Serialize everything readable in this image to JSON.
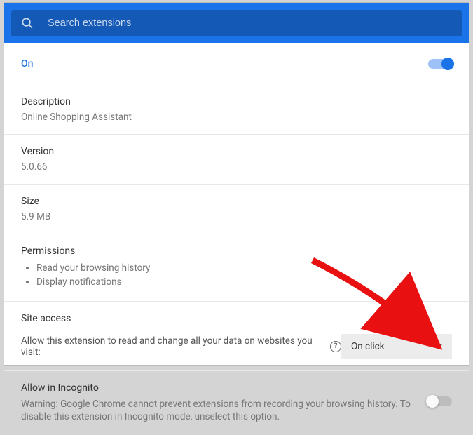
{
  "header": {
    "search_placeholder": "Search extensions"
  },
  "status": {
    "on_label": "On",
    "enabled": true
  },
  "description": {
    "title": "Description",
    "value": "Online Shopping Assistant"
  },
  "version": {
    "title": "Version",
    "value": "5.0.66"
  },
  "size": {
    "title": "Size",
    "value": "5.9 MB"
  },
  "permissions": {
    "title": "Permissions",
    "items": [
      "Read your browsing history",
      "Display notifications"
    ]
  },
  "site_access": {
    "title": "Site access",
    "label": "Allow this extension to read and change all your data on websites you visit:",
    "dropdown_value": "On click"
  },
  "incognito": {
    "title": "Allow in Incognito",
    "warning": "Warning: Google Chrome cannot prevent extensions from recording your browsing history. To disable this extension in Incognito mode, unselect this option.",
    "enabled": false
  }
}
